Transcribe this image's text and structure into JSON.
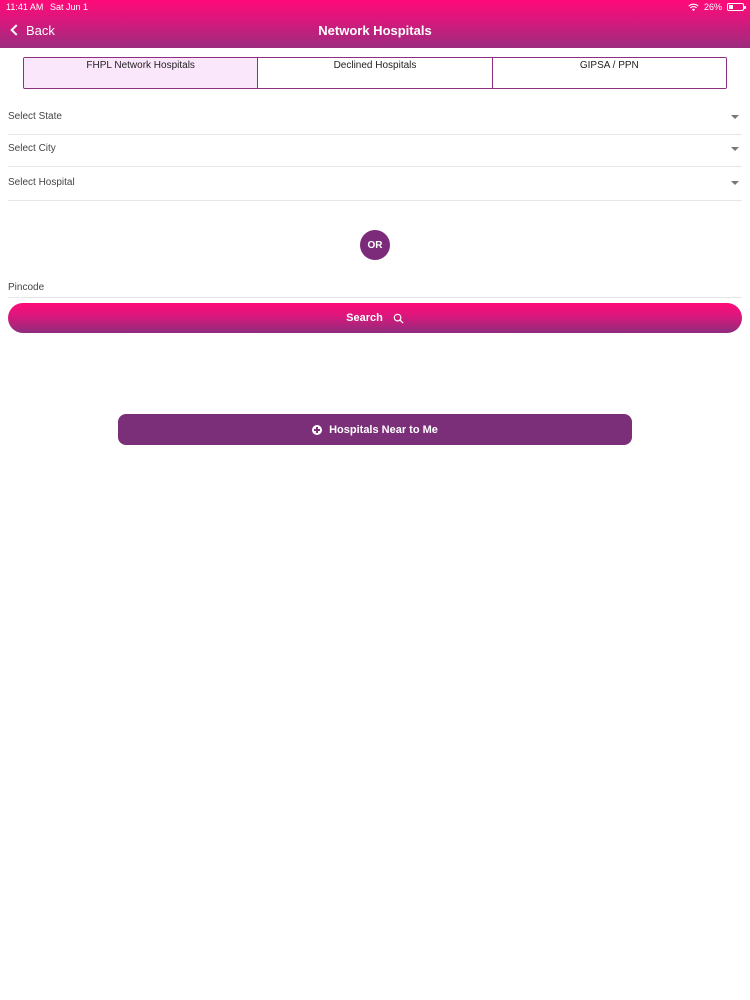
{
  "status_bar": {
    "time": "11:41 AM",
    "date": "Sat Jun 1",
    "battery": "26%"
  },
  "header": {
    "back_label": "Back",
    "title": "Network Hospitals"
  },
  "tabs": [
    {
      "label": "FHPL Network Hospitals",
      "active": true
    },
    {
      "label": "Declined Hospitals",
      "active": false
    },
    {
      "label": "GIPSA / PPN",
      "active": false
    }
  ],
  "selects": {
    "state": "Select State",
    "city": "Select City",
    "hospital": "Select Hospital"
  },
  "or_label": "OR",
  "pincode": {
    "placeholder": "Pincode",
    "value": ""
  },
  "search_label": "Search",
  "near_me_label": "Hospitals Near to Me",
  "colors": {
    "brand_pink": "#ff0a78",
    "brand_purple": "#7b2b79",
    "active_tab_bg": "#fbe7fb"
  },
  "icons": {
    "back": "chevron-left-icon",
    "wifi": "wifi-icon",
    "battery": "battery-icon",
    "dropdown": "caret-down-icon",
    "search": "search-icon",
    "near_me": "plus-circle-icon"
  }
}
